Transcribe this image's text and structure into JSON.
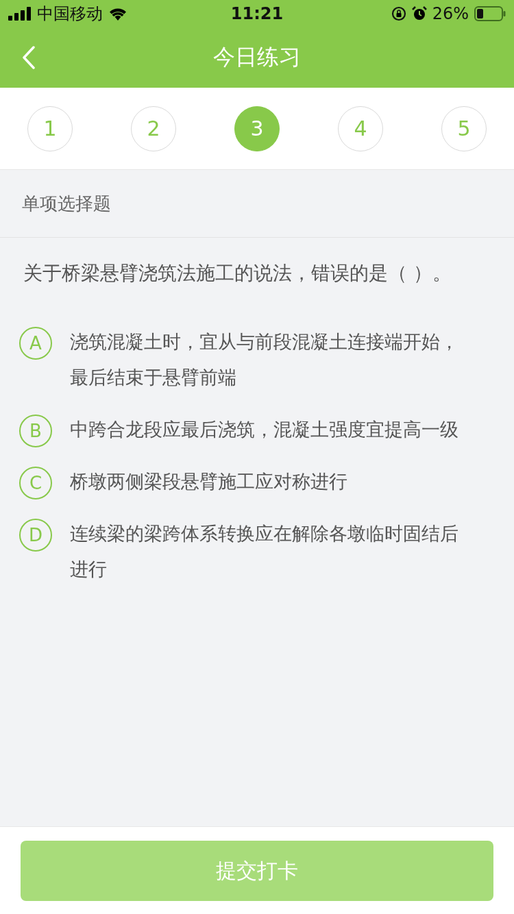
{
  "status_bar": {
    "carrier": "中国移动",
    "time": "11:21",
    "battery": "26%"
  },
  "nav": {
    "title": "今日练习"
  },
  "steps": [
    {
      "label": "1",
      "selected": false
    },
    {
      "label": "2",
      "selected": false
    },
    {
      "label": "3",
      "selected": true
    },
    {
      "label": "4",
      "selected": false
    },
    {
      "label": "5",
      "selected": false
    }
  ],
  "section": "单项选择题",
  "question": "关于桥梁悬臂浇筑法施工的说法，错误的是（   ）。",
  "options": [
    {
      "letter": "A",
      "text": "浇筑混凝土时，宜从与前段混凝土连接端开始，最后结束于悬臂前端",
      "selected": false
    },
    {
      "letter": "B",
      "text": "中跨合龙段应最后浇筑，混凝土强度宜提高一级",
      "selected": false
    },
    {
      "letter": "C",
      "text": "桥墩两侧梁段悬臂施工应对称进行",
      "selected": false
    },
    {
      "letter": "D",
      "text": "连续梁的梁跨体系转换应在解除各墩临时固结后进行",
      "selected": false
    }
  ],
  "submit": {
    "label": "提交打卡",
    "disabled": true
  }
}
